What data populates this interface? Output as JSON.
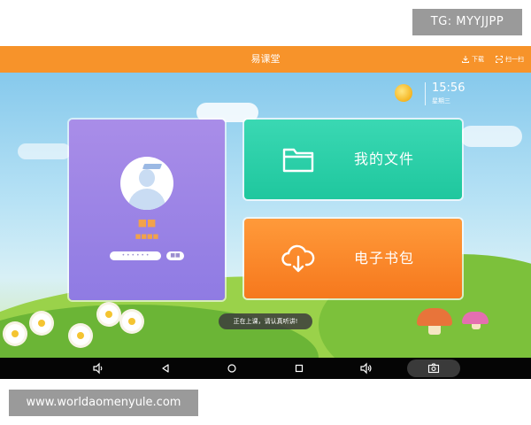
{
  "watermarks": {
    "top": "TG: MYYJJPP",
    "bottom": "www.worldaomenyule.com"
  },
  "app": {
    "title": "易课堂",
    "download_label": "下载",
    "scan_label": "扫一扫",
    "download_icon": "download-icon",
    "scan_icon": "scan-icon"
  },
  "status": {
    "time": "15:56",
    "day": "星期三",
    "weather_icon": "sun-icon"
  },
  "profile": {
    "name": "■■",
    "class_label": "■■■■",
    "id_text": "• • • • • •",
    "id_badge": "■■"
  },
  "tiles": [
    {
      "label": "我的文件",
      "icon": "folder-icon",
      "color": "#1fc79e"
    },
    {
      "label": "电子书包",
      "icon": "cloud-download-icon",
      "color": "#f6781d"
    }
  ],
  "toast": "正在上课，请认真听讲!",
  "navbar": {
    "buttons": [
      "volume-down-icon",
      "back-icon",
      "home-icon",
      "recents-icon",
      "volume-up-icon",
      "screenshot-icon"
    ]
  },
  "colors": {
    "topbar": "#f7932a",
    "profile_card": "#8f7be3",
    "navbar": "#050505"
  }
}
